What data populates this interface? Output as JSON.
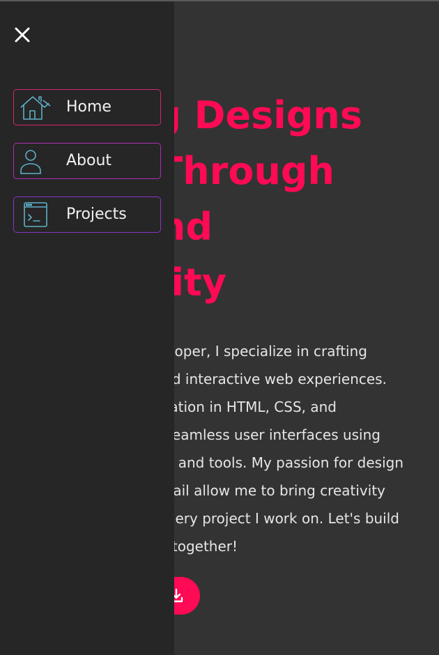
{
  "hero": {
    "title_lines": [
      "g Designs",
      "Through",
      "nd",
      "ity"
    ],
    "description_lines": [
      "oper, I specialize in crafting",
      "d interactive web experiences.",
      "ation in HTML, CSS, and",
      "eamless user interfaces using",
      "and tools. My passion for design",
      "ail allow me to bring creativity",
      "ery project I work on. Let's build",
      "together!"
    ],
    "download_icon": "download-icon"
  },
  "drawer": {
    "close_icon": "close-icon",
    "items": [
      {
        "label": "Home",
        "icon": "house-icon"
      },
      {
        "label": "About",
        "icon": "user-icon"
      },
      {
        "label": "Projects",
        "icon": "terminal-window-icon"
      }
    ]
  },
  "colors": {
    "accent": "#ff0a54",
    "page_background": "#333333",
    "drawer_background": "#262626",
    "icon_stroke": "#5fb0c8",
    "text": "#f2f2f2"
  }
}
